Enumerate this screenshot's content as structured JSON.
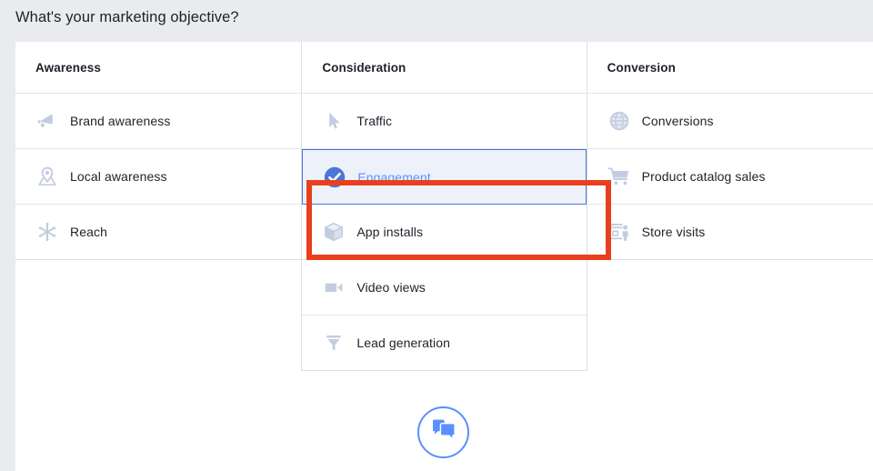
{
  "page": {
    "title": "What's your marketing objective?",
    "background_color": "#e9ebee",
    "card_background": "#ffffff"
  },
  "colors": {
    "accent_blue": "#5890ff",
    "selected_check_blue": "#4a76d4",
    "selected_row_background": "#edf2fa",
    "selected_row_border": "#4a76d4",
    "annotation_red": "#e8401f",
    "icon_gray_blue": "#c3cde0",
    "text_dark": "#1d2129",
    "divider": "#e5e7ea"
  },
  "columns": [
    {
      "header": "Awareness",
      "items": [
        {
          "label": "Brand awareness",
          "icon": "megaphone-icon",
          "selected": false
        },
        {
          "label": "Local awareness",
          "icon": "location-pin-map-icon",
          "selected": false
        },
        {
          "label": "Reach",
          "icon": "reach-burst-icon",
          "selected": false
        }
      ]
    },
    {
      "header": "Consideration",
      "items": [
        {
          "label": "Traffic",
          "icon": "cursor-arrow-icon",
          "selected": false
        },
        {
          "label": "Engagement",
          "icon": "check-circle-icon",
          "selected": true
        },
        {
          "label": "App installs",
          "icon": "cube-box-icon",
          "selected": false
        },
        {
          "label": "Video views",
          "icon": "video-camera-icon",
          "selected": false
        },
        {
          "label": "Lead generation",
          "icon": "funnel-icon",
          "selected": false
        }
      ]
    },
    {
      "header": "Conversion",
      "items": [
        {
          "label": "Conversions",
          "icon": "globe-icon",
          "selected": false
        },
        {
          "label": "Product catalog sales",
          "icon": "shopping-cart-icon",
          "selected": false
        },
        {
          "label": "Store visits",
          "icon": "storefront-person-icon",
          "selected": false
        }
      ]
    }
  ],
  "annotation": {
    "name": "red-highlight-box",
    "targets": "Engagement",
    "color": "#e8401f"
  },
  "chat_button": {
    "icon": "chat-bubbles-icon",
    "color": "#5890ff"
  }
}
